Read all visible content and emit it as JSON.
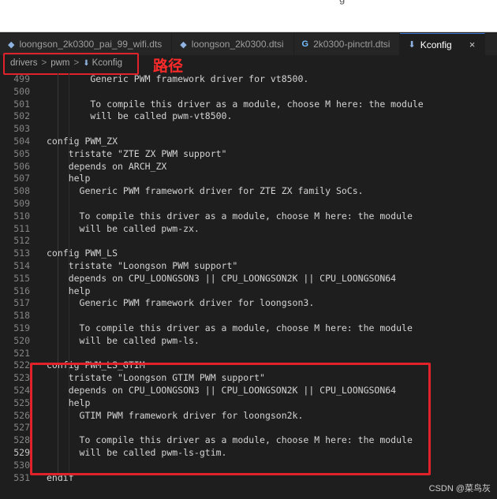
{
  "topbar": {
    "partial_text": "g"
  },
  "tabs": [
    {
      "label": "loongson_2k0300_pai_99_wifi.dts",
      "icon": "devicetree-file-icon"
    },
    {
      "label": "loongson_2k0300.dtsi",
      "icon": "devicetree-file-icon"
    },
    {
      "label": "2k0300-pinctrl.dtsi",
      "icon": "c-file-icon"
    },
    {
      "label": "Kconfig",
      "icon": "kconfig-file-icon",
      "active": true,
      "close": "×"
    }
  ],
  "breadcrumb": {
    "items": [
      "drivers",
      "pwm",
      "Kconfig"
    ],
    "separator": ">"
  },
  "annotation": {
    "label": "路径"
  },
  "code_lines": [
    {
      "n": "499",
      "text": "        Generic PWM framework driver for vt8500."
    },
    {
      "n": "500",
      "text": ""
    },
    {
      "n": "501",
      "text": "        To compile this driver as a module, choose M here: the module"
    },
    {
      "n": "502",
      "text": "        will be called pwm-vt8500."
    },
    {
      "n": "503",
      "text": ""
    },
    {
      "n": "504",
      "text": "config PWM_ZX"
    },
    {
      "n": "505",
      "text": "    tristate \"ZTE ZX PWM support\""
    },
    {
      "n": "506",
      "text": "    depends on ARCH_ZX"
    },
    {
      "n": "507",
      "text": "    help"
    },
    {
      "n": "508",
      "text": "      Generic PWM framework driver for ZTE ZX family SoCs."
    },
    {
      "n": "509",
      "text": ""
    },
    {
      "n": "510",
      "text": "      To compile this driver as a module, choose M here: the module"
    },
    {
      "n": "511",
      "text": "      will be called pwm-zx."
    },
    {
      "n": "512",
      "text": ""
    },
    {
      "n": "513",
      "text": "config PWM_LS"
    },
    {
      "n": "514",
      "text": "    tristate \"Loongson PWM support\""
    },
    {
      "n": "515",
      "text": "    depends on CPU_LOONGSON3 || CPU_LOONGSON2K || CPU_LOONGSON64"
    },
    {
      "n": "516",
      "text": "    help"
    },
    {
      "n": "517",
      "text": "      Generic PWM framework driver for loongson3."
    },
    {
      "n": "518",
      "text": ""
    },
    {
      "n": "519",
      "text": "      To compile this driver as a module, choose M here: the module"
    },
    {
      "n": "520",
      "text": "      will be called pwm-ls."
    },
    {
      "n": "521",
      "text": ""
    },
    {
      "n": "522",
      "text": "config PWM_LS_GTIM"
    },
    {
      "n": "523",
      "text": "    tristate \"Loongson GTIM PWM support\""
    },
    {
      "n": "524",
      "text": "    depends on CPU_LOONGSON3 || CPU_LOONGSON2K || CPU_LOONGSON64"
    },
    {
      "n": "525",
      "text": "    help"
    },
    {
      "n": "526",
      "text": "      GTIM PWM framework driver for loongson2k."
    },
    {
      "n": "527",
      "text": ""
    },
    {
      "n": "528",
      "text": "      To compile this driver as a module, choose M here: the module"
    },
    {
      "n": "529",
      "text": "      will be called pwm-ls-gtim.",
      "current": true
    },
    {
      "n": "530",
      "text": ""
    },
    {
      "n": "531",
      "text": "endif"
    }
  ],
  "watermark": "CSDN @菜鸟灰",
  "colors": {
    "background": "#1e1e1e",
    "highlight_box": "#e1222a",
    "annotation_text": "#ff2a2a",
    "active_tab_accent": "#3a7bd5"
  }
}
